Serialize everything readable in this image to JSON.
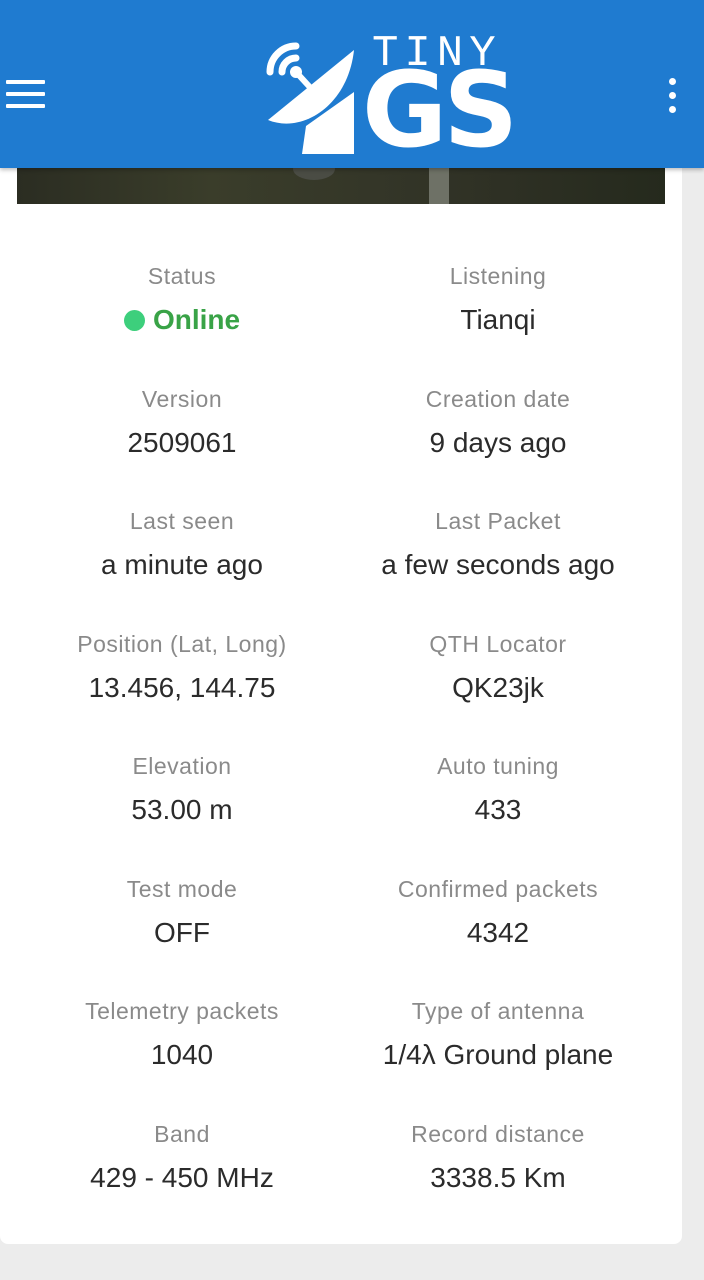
{
  "header": {
    "logo_top": "TINY",
    "logo_bottom": "GS"
  },
  "station": {
    "status_label": "Status",
    "status_value": "Online",
    "listening_label": "Listening",
    "listening_value": "Tianqi",
    "version_label": "Version",
    "version_value": "2509061",
    "creation_label": "Creation date",
    "creation_value": "9 days ago",
    "last_seen_label": "Last seen",
    "last_seen_value": "a minute ago",
    "last_packet_label": "Last Packet",
    "last_packet_value": "a few seconds ago",
    "position_label": "Position (Lat, Long)",
    "position_value": "13.456, 144.75",
    "qth_label": "QTH Locator",
    "qth_value": "QK23jk",
    "elevation_label": "Elevation",
    "elevation_value": "53.00 m",
    "auto_tuning_label": "Auto tuning",
    "auto_tuning_value": "433",
    "test_mode_label": "Test mode",
    "test_mode_value": "OFF",
    "confirmed_label": "Confirmed packets",
    "confirmed_value": "4342",
    "telemetry_label": "Telemetry packets",
    "telemetry_value": "1040",
    "antenna_label": "Type of antenna",
    "antenna_value": "1/4λ Ground plane",
    "band_label": "Band",
    "band_value": "429 - 450 MHz",
    "record_label": "Record distance",
    "record_value": "3338.5 Km"
  },
  "colors": {
    "appbar": "#1f7bd0",
    "online_green": "#39a347",
    "online_dot": "#3dcf7c"
  }
}
